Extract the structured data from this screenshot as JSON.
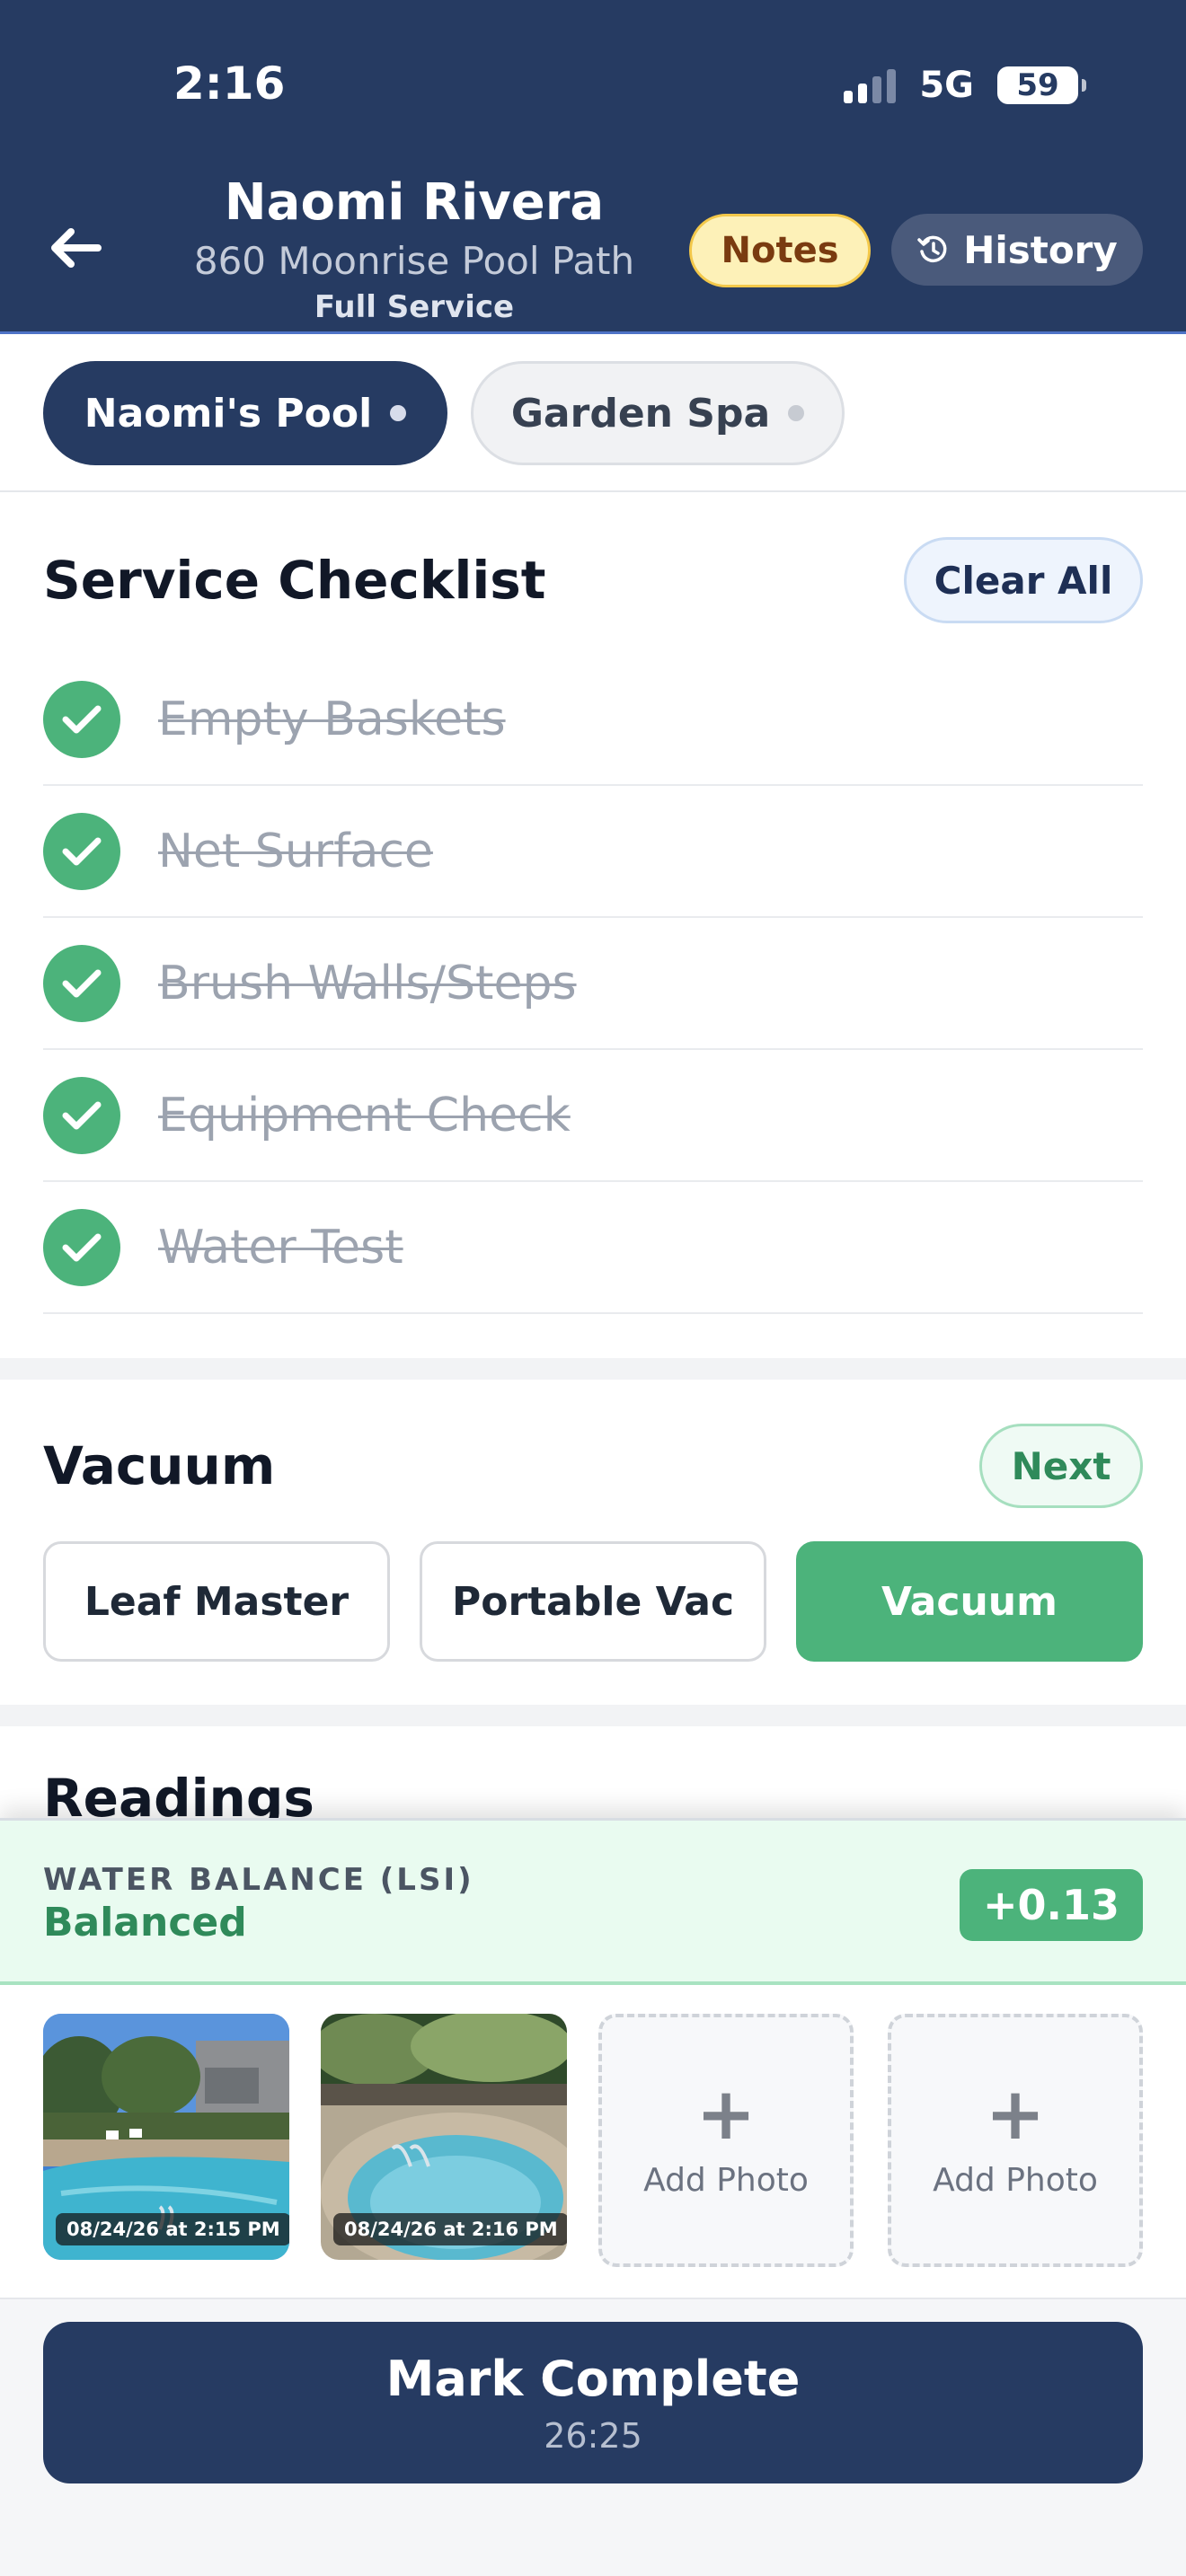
{
  "status_bar": {
    "time": "2:16",
    "network": "5G",
    "battery": "59"
  },
  "header": {
    "client_name": "Naomi Rivera",
    "address": "860 Moonrise Pool Path",
    "service_type": "Full Service",
    "notes_label": "Notes",
    "history_label": "History",
    "icons": {
      "back": "back-arrow-icon",
      "history": "history-clock-icon"
    }
  },
  "tabs": [
    {
      "label": "Naomi's Pool",
      "active": true
    },
    {
      "label": "Garden Spa",
      "active": false
    }
  ],
  "checklist": {
    "title": "Service Checklist",
    "clear_label": "Clear All",
    "items": [
      {
        "label": "Empty Baskets",
        "done": true
      },
      {
        "label": "Net Surface",
        "done": true
      },
      {
        "label": "Brush Walls/Steps",
        "done": true
      },
      {
        "label": "Equipment Check",
        "done": true
      },
      {
        "label": "Water Test",
        "done": true
      }
    ]
  },
  "vacuum": {
    "title": "Vacuum",
    "next_label": "Next",
    "options": [
      {
        "label": "Leaf Master",
        "selected": false
      },
      {
        "label": "Portable Vac",
        "selected": false
      },
      {
        "label": "Vacuum",
        "selected": true
      }
    ]
  },
  "readings": {
    "title": "Readings"
  },
  "water_balance": {
    "label": "WATER BALANCE (LSI)",
    "status": "Balanced",
    "value": "+0.13"
  },
  "photos": [
    {
      "timestamp": "08/24/26 at 2:15 PM",
      "subject": "pool"
    },
    {
      "timestamp": "08/24/26 at 2:16 PM",
      "subject": "spa"
    }
  ],
  "add_photo_label": "Add Photo",
  "complete": {
    "label": "Mark Complete",
    "timer": "26:25"
  },
  "colors": {
    "navy": "#263b62",
    "green": "#4cb37b",
    "notes_bg": "#fdf1b8",
    "notes_text": "#7a3b10"
  }
}
